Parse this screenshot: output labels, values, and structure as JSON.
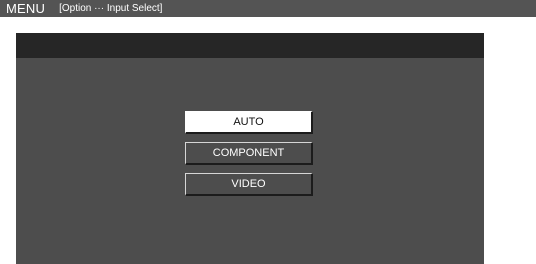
{
  "title_bar": {
    "menu_label": "MENU",
    "path_label": "[Option ··· Input Select]"
  },
  "options": [
    {
      "label": "AUTO",
      "selected": true
    },
    {
      "label": "COMPONENT",
      "selected": false
    },
    {
      "label": "VIDEO",
      "selected": false
    }
  ],
  "colors": {
    "title_bar_bg": "#545454",
    "screen_bg": "#4d4d4d",
    "screen_header_bg": "#262626",
    "selected_bg": "#ffffff"
  }
}
